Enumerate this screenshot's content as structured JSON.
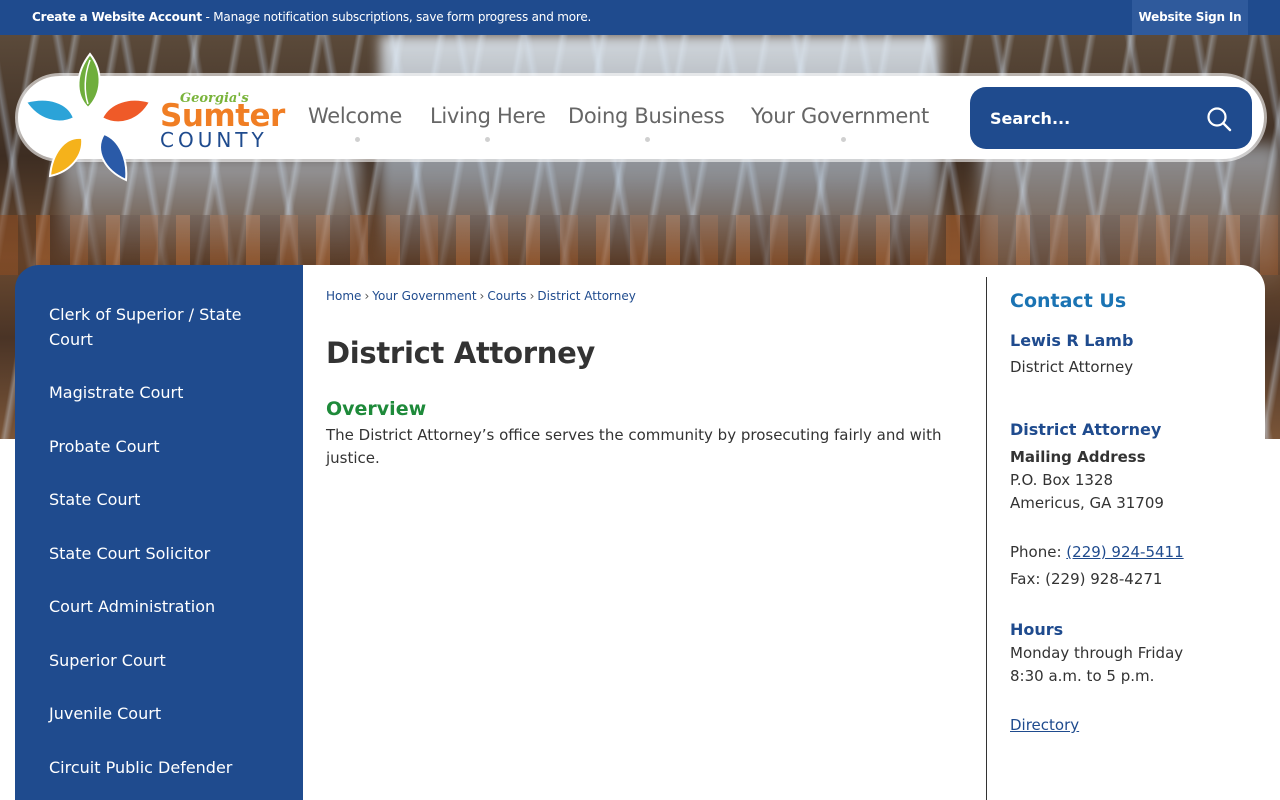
{
  "topbar": {
    "account_bold": "Create a Website Account",
    "account_rest": " - Manage notification subscriptions, save form progress and more.",
    "sign_in": "Website Sign In"
  },
  "logo": {
    "line1": "Georgia's",
    "line2": "Sumter",
    "line3": "COUNTY"
  },
  "nav": {
    "items": [
      "Welcome",
      "Living Here",
      "Doing Business",
      "Your Government"
    ]
  },
  "search": {
    "placeholder": "Search..."
  },
  "sidebar": {
    "items": [
      "Clerk of Superior / State Court",
      "Magistrate Court",
      "Probate Court",
      "State Court",
      "State Court Solicitor",
      "Court Administration",
      "Superior Court",
      "Juvenile Court",
      "Circuit Public Defender"
    ]
  },
  "breadcrumb": {
    "items": [
      "Home",
      "Your Government",
      "Courts",
      "District Attorney"
    ],
    "separator": "›"
  },
  "main": {
    "title": "District Attorney",
    "overview_heading": "Overview",
    "overview_text": "The District Attorney’s office serves the community by prosecuting fairly and with justice."
  },
  "contact": {
    "heading": "Contact Us",
    "name": "Lewis R Lamb",
    "role": "District Attorney",
    "department": "District Attorney",
    "mailing_label": "Mailing Address",
    "address_line1": "P.O. Box 1328",
    "address_line2": "Americus, GA 31709",
    "phone_label": "Phone: ",
    "phone": "(229) 924-5411",
    "fax": "Fax: (229) 928-4271",
    "hours_heading": "Hours",
    "hours_line1": "Monday through Friday",
    "hours_line2": "8:30 a.m. to 5 p.m.",
    "directory": "Directory"
  },
  "colors": {
    "brand_blue": "#1f4b8e",
    "accent_orange": "#f07e24",
    "accent_green": "#1e8a3a",
    "link_blue": "#1a73b3"
  }
}
